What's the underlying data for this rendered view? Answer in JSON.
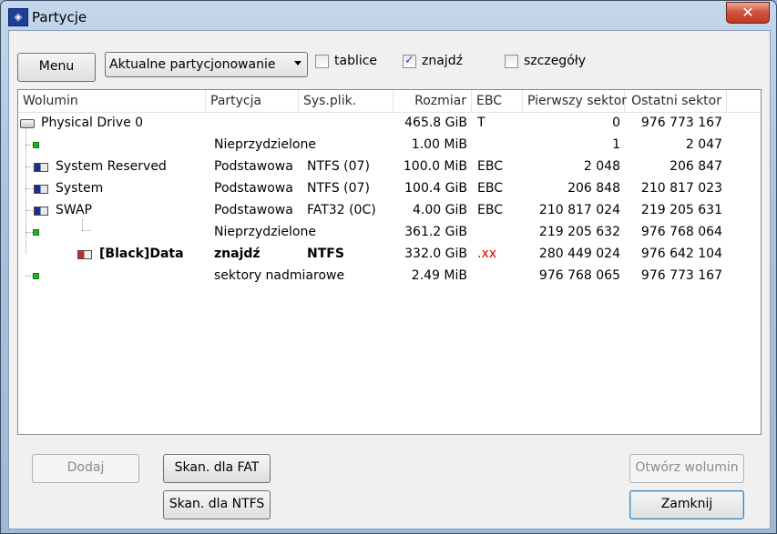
{
  "window": {
    "title": "Partycje",
    "close_glyph": "✕",
    "app_icon_glyph": "◈"
  },
  "toolbar": {
    "menu_label": "Menu",
    "view_combo_value": "Aktualne partycjonowanie",
    "checkboxes": [
      {
        "label": "tablice",
        "checked": false
      },
      {
        "label": "znajdź",
        "checked": true
      },
      {
        "label": "szczegóły",
        "checked": false
      }
    ]
  },
  "table": {
    "columns": [
      "Wolumin",
      "Partycja",
      "Sys.plik.",
      "Rozmiar",
      "EBC",
      "Pierwszy sektor",
      "Ostatni sektor"
    ],
    "rows": [
      {
        "icon": "drive-icon",
        "volume": "Physical Drive 0",
        "partition": "",
        "fs": "",
        "size": "465.8 GiB",
        "ebc": "T",
        "first": "0",
        "last": "976 773 167",
        "bold": false
      },
      {
        "icon": "unallocated-icon",
        "volume": "",
        "partition": "Nieprzydzielone",
        "fs": "",
        "size": "1.00 MiB",
        "ebc": "",
        "first": "1",
        "last": "2 047",
        "bold": false
      },
      {
        "icon": "partition-icon",
        "volume": "System Reserved",
        "partition": "Podstawowa",
        "fs": "NTFS (07)",
        "size": "100.0 MiB",
        "ebc": "EBC",
        "first": "2 048",
        "last": "206 847",
        "bold": false
      },
      {
        "icon": "partition-icon",
        "volume": "System",
        "partition": "Podstawowa",
        "fs": "NTFS (07)",
        "size": "100.4 GiB",
        "ebc": "EBC",
        "first": "206 848",
        "last": "210 817 023",
        "bold": false
      },
      {
        "icon": "partition-icon",
        "volume": "SWAP",
        "partition": "Podstawowa",
        "fs": "FAT32 (0C)",
        "size": "4.00 GiB",
        "ebc": "EBC",
        "first": "210 817 024",
        "last": "219 205 631",
        "bold": false
      },
      {
        "icon": "unallocated-icon",
        "volume": "",
        "partition": "Nieprzydzielone",
        "fs": "",
        "size": "361.2 GiB",
        "ebc": "",
        "first": "219 205 632",
        "last": "976 768 064",
        "bold": false
      },
      {
        "icon": "found-partition-icon",
        "volume": "[Black]Data",
        "partition": "znajdź",
        "fs": "NTFS",
        "size": "332.0 GiB",
        "ebc": ".xx",
        "first": "280 449 024",
        "last": "976 642 104",
        "bold": true
      },
      {
        "icon": "unallocated-icon",
        "volume": "",
        "partition": "sektory nadmiarowe",
        "fs": "",
        "size": "2.49 MiB",
        "ebc": "",
        "first": "976 768 065",
        "last": "976 773 167",
        "bold": false
      }
    ]
  },
  "buttons": {
    "add": "Dodaj",
    "scan_fat": "Skan. dla FAT",
    "scan_ntfs": "Skan. dla NTFS",
    "open_volume": "Otwórz wolumin",
    "close": "Zamknij"
  },
  "colors": {
    "found_ebc": "#dd0000",
    "partition_primary": "#1c2e8c",
    "unallocated": "#22b022"
  }
}
